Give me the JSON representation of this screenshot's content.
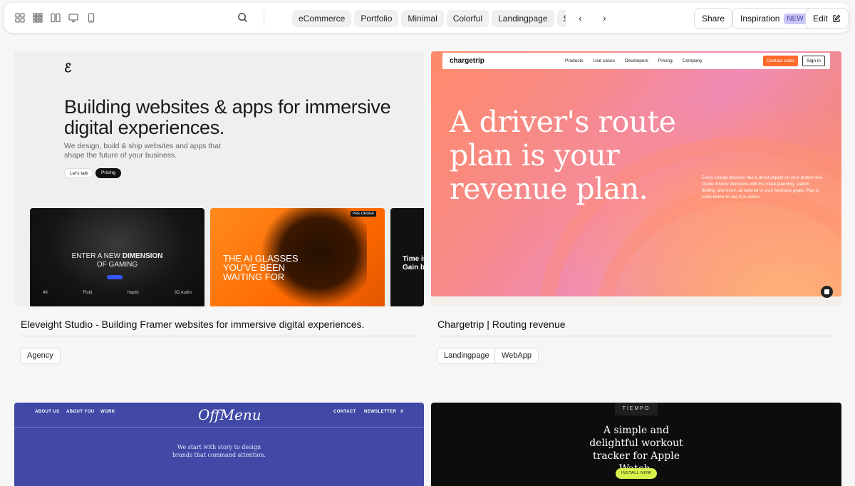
{
  "toolbar": {
    "view_icons": [
      "grid-large-icon",
      "grid-small-icon",
      "columns-icon",
      "desktop-icon",
      "mobile-icon"
    ],
    "categories": [
      "eCommerce",
      "Portfolio",
      "Minimal",
      "Colorful",
      "Landingpage",
      "Startup"
    ],
    "prev_arrow": "‹",
    "next_arrow": "›",
    "share_label": "Share",
    "inspiration_label": "Inspiration",
    "new_badge": "NEW",
    "edit_label": "Edit"
  },
  "cards": [
    {
      "title": "Eleveight Studio - Building Framer websites for immersive digital experiences.",
      "tags": [
        "Agency"
      ],
      "thumb": {
        "logo": "ℰ",
        "headline": "Building websites & apps for immersive digital experiences.",
        "subtext": "We design, build & ship websites and apps that shape the future of your business.",
        "btn_primary": "Let's talk",
        "btn_secondary": "Pricing",
        "mini1_title_a": "ENTER A NEW ",
        "mini1_title_b": "DIMENSION",
        "mini1_title_c": "OF GAMING",
        "mini1_stats": [
          "4K",
          "Fluid",
          "Haptic",
          "3D Audio"
        ],
        "mini2_title": "THE AI GLASSES YOU'VE BEEN WAITING FOR",
        "mini2_badge": "PRE-ORDER",
        "mini3_title": "Time is Gain b"
      }
    },
    {
      "title": "Chargetrip | Routing revenue",
      "tags": [
        "Landingpage",
        "WebApp"
      ],
      "thumb": {
        "logo": "chargetrip",
        "nav": [
          "Products",
          "Use cases",
          "Developers",
          "Pricing",
          "Company"
        ],
        "contact": "Contact sales",
        "signin": "Sign in",
        "headline": "A driver's route plan is your revenue plan.",
        "body": "Every charge decision has a direct impact on your bottom line. Guide drivers' decisions with EV route planning, station finding, and more, all tailored to your business goals. Plan a route below to see it in action."
      }
    },
    {
      "thumb": {
        "nav_left": [
          "ABOUT US",
          "ABOUT YOU",
          "WORK"
        ],
        "nav_right": [
          "CONTACT",
          "NEWSLETTER",
          "X"
        ],
        "logo": "OffMenu",
        "text": "We start with story to design brands that command attention."
      }
    },
    {
      "thumb": {
        "logo": "TIEMPO",
        "headline": "A simple and delightful workout tracker for Apple Watch.",
        "cta": "INSTALL NOW"
      }
    }
  ]
}
